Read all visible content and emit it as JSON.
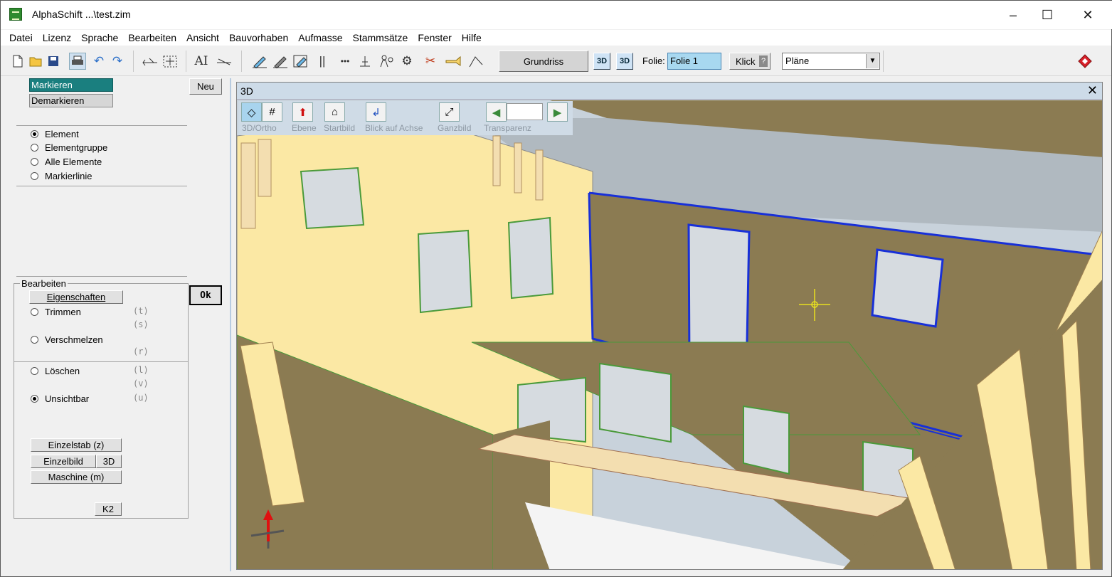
{
  "window": {
    "title": "AlphaSchift ...\\test.zim",
    "minimize": "–",
    "maximize": "☐",
    "close": "✕"
  },
  "menu": [
    "Datei",
    "Lizenz",
    "Sprache",
    "Bearbeiten",
    "Ansicht",
    "Bauvorhaben",
    "Aufmasse",
    "Stammsätze",
    "Fenster",
    "Hilfe"
  ],
  "toolbar": {
    "grundriss": "Grundriss",
    "btn_3d_a": "3D",
    "btn_3d_b": "3D",
    "folie_label": "Folie:",
    "folie_value": "Folie 1",
    "klick": "Klick",
    "klick_help": "?",
    "plans_selected": "Pläne",
    "icons": [
      "new-file-icon",
      "open-folder-icon",
      "save-icon",
      "print-icon",
      "undo-icon",
      "redo-icon",
      "dimension-icon",
      "move-icon",
      "text-icon",
      "line-text-icon",
      "pencil-icon",
      "pencil-edit-icon",
      "pencil-box-icon",
      "parallel-icon",
      "dots-line-icon",
      "anchor-icon",
      "person-icon",
      "gear-icon",
      "tools-icon",
      "hand-icon",
      "angle-icon",
      "help-diamond-icon"
    ]
  },
  "left_panel": {
    "markieren": "Markieren",
    "demarkieren": "Demarkieren",
    "neu": "Neu",
    "select_modes": [
      {
        "label": "Element",
        "checked": true
      },
      {
        "label": "Elementgruppe",
        "checked": false
      },
      {
        "label": "Alle Elemente",
        "checked": false
      },
      {
        "label": "Markierlinie",
        "checked": false
      }
    ],
    "bearbeiten_title": "Bearbeiten",
    "eigenschaften": "Eigenschaften",
    "ok": "Ok",
    "trimmen": "Trimmen",
    "trimmen_key": "(t)",
    "key_s": "(s)",
    "verschmelzen": "Verschmelzen",
    "key_r": "(r)",
    "loeschen": "Löschen",
    "loeschen_key": "(l)",
    "key_v": "(v)",
    "unsichtbar": "Unsichtbar",
    "unsichtbar_key": "(u)",
    "einzelstab": "Einzelstab (z)",
    "einzelbild": "Einzelbild",
    "einzelbild_3d": "3D",
    "maschine": "Maschine (m)",
    "k2": "K2"
  },
  "view3d": {
    "title": "3D",
    "close": "✕",
    "tools": [
      "3D/Ortho",
      "Ebene",
      "Startbild",
      "Blick auf Achse",
      "Ganzbild",
      "Transparenz"
    ]
  },
  "colors": {
    "wall": "#8b7b52",
    "timber": "#fbe8a4",
    "selection": "#1830d8",
    "cursor": "#e8e020"
  }
}
